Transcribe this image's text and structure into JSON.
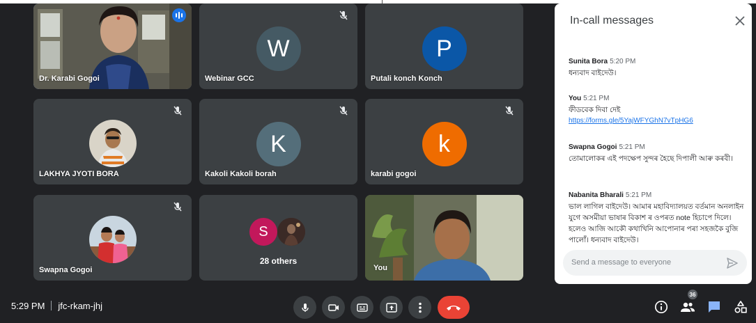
{
  "participants": [
    {
      "name": "Dr. Karabi Gogoi",
      "type": "video",
      "speaking": true
    },
    {
      "name": "Webinar GCC",
      "type": "letter",
      "letter": "W",
      "color": "#455a64",
      "muted": true
    },
    {
      "name": "Putali konch Konch",
      "type": "letter",
      "letter": "P",
      "color": "#0b57a7",
      "muted": false
    },
    {
      "name": "LAKHYA JYOTI BORA",
      "type": "photo",
      "muted": true
    },
    {
      "name": "Kakoli Kakoli borah",
      "type": "letter",
      "letter": "K",
      "color": "#546e7a",
      "muted": true
    },
    {
      "name": "karabi gogoi",
      "type": "letter",
      "letter": "k",
      "color": "#ef6c00",
      "muted": true
    },
    {
      "name": "Swapna Gogoi",
      "type": "photo",
      "muted": true
    },
    {
      "name": "28 others",
      "type": "others",
      "letter": "S",
      "color": "#c2185b"
    },
    {
      "name": "You",
      "type": "video"
    }
  ],
  "chat": {
    "title": "In-call messages",
    "messages": [
      {
        "sender": "Sunita Bora",
        "time": "5:20 PM",
        "text": "ধন্যবাদ বাইদেউ।"
      },
      {
        "sender": "You",
        "time": "5:21 PM",
        "text": "ফীডবেক দিবা দেই",
        "link": "https://forms.gle/5YajWFYGhN7vTpHG6"
      },
      {
        "sender": "Swapna Gogoi",
        "time": "5:21 PM",
        "text": "তোমালোকৰ এই পদক্ষেপ সুন্দৰ হৈছে দিপালী আৰু কৰবী।"
      },
      {
        "sender": "Nabanita Bharali",
        "time": "5:21 PM",
        "text": "ভাল লাগিল বাইদেউ। আমাৰ মহাবিদ্যালয়ত বৰ্তমান অনলাইন যুগে অসমীয়া ভাষাৰ বিকাশ ৰ ওপৰত note হিচাপে দিলে। হলেও আজি আকৌ কথাখিনি আপোনাৰ পৰা সহজকৈ বুজি পালোঁ। ধন্যবাদ বাইদেউ।"
      }
    ],
    "input_placeholder": "Send a message to everyone"
  },
  "bottom_bar": {
    "time": "5:29 PM",
    "meeting_code": "jfc-rkam-jhj",
    "people_count": "36"
  },
  "colors": {
    "background": "#202124",
    "tile": "#3c4043",
    "end_call": "#ea4335",
    "accent": "#8ab4f8"
  },
  "icons": [
    "mic-icon",
    "camera-icon",
    "captions-icon",
    "present-icon",
    "more-options-icon",
    "end-call-icon",
    "info-icon",
    "people-icon",
    "chat-icon",
    "activities-icon",
    "close-icon",
    "send-icon",
    "mic-off-icon"
  ]
}
